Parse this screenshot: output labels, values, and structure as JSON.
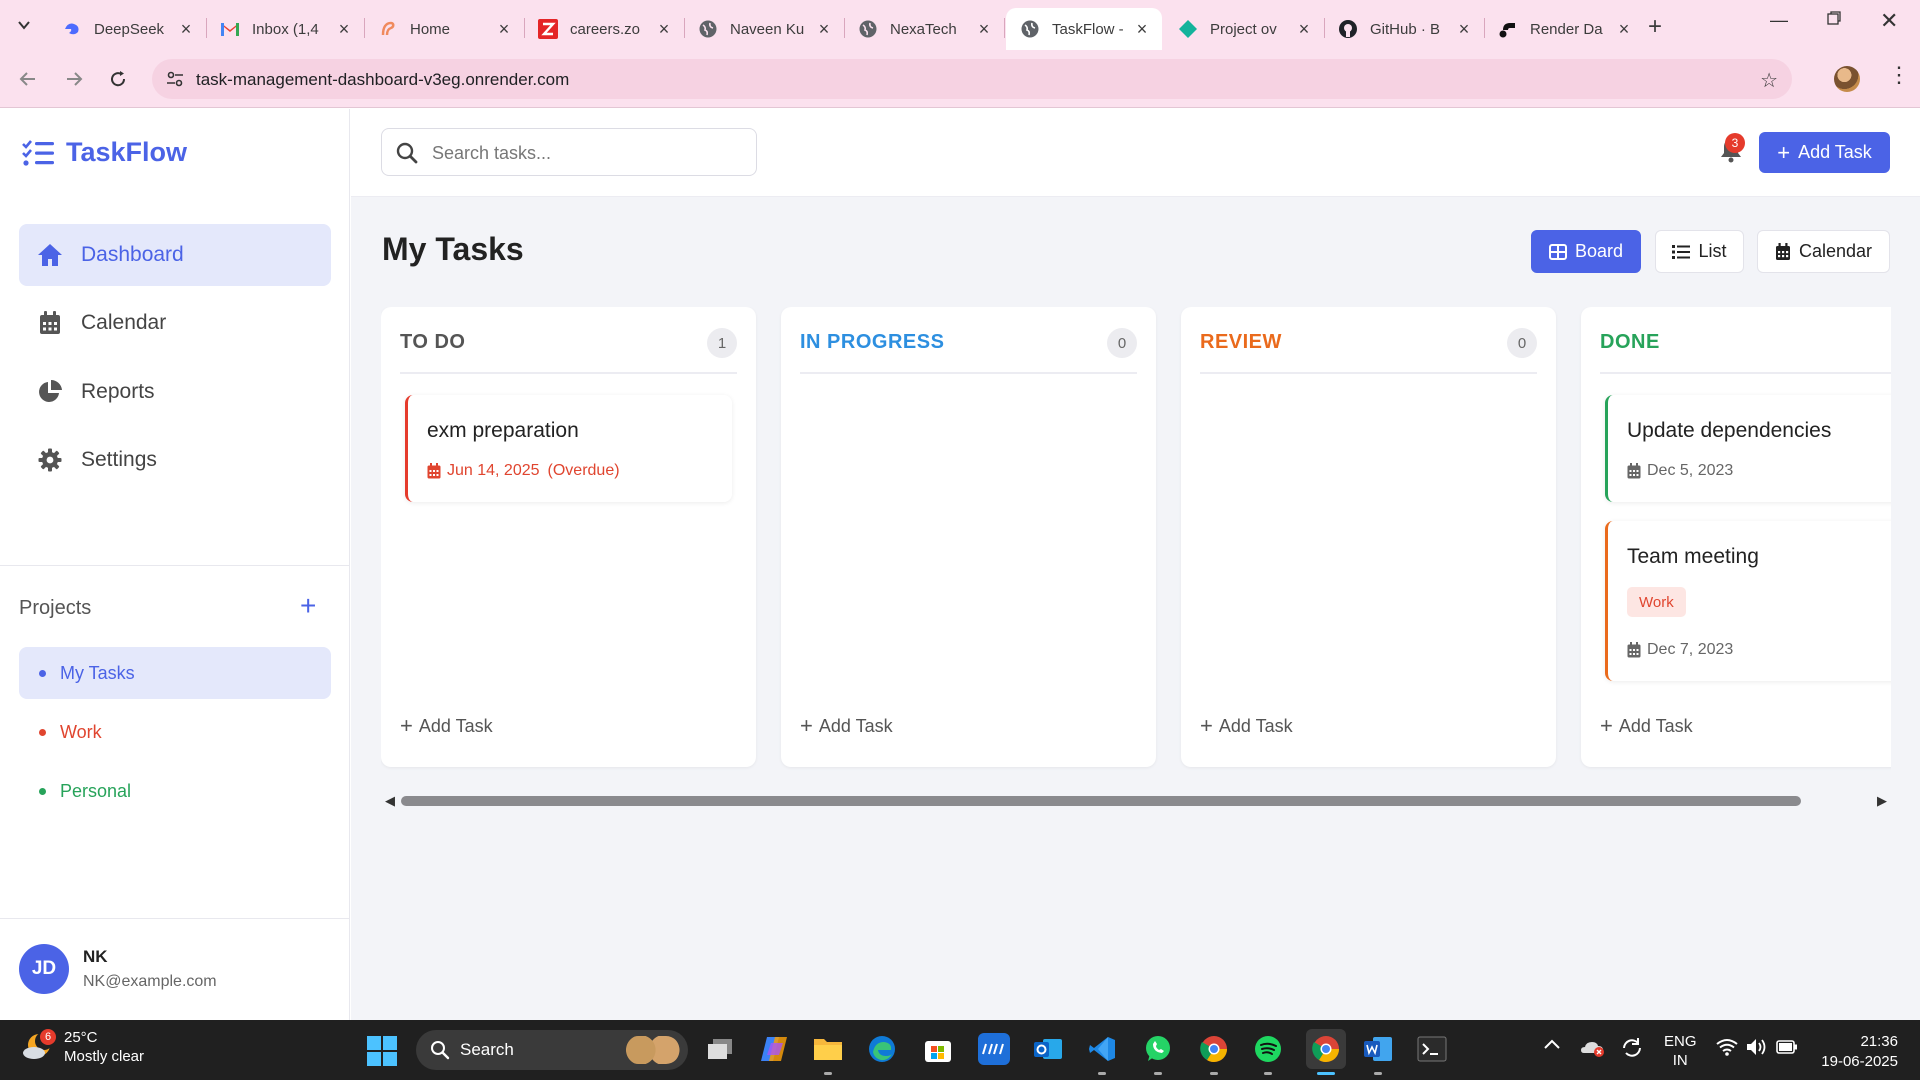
{
  "browser": {
    "tabs": [
      {
        "title": "DeepSeek",
        "icon": "deepseek-icon",
        "active": false
      },
      {
        "title": "Inbox (1,4",
        "icon": "gmail-icon",
        "active": false
      },
      {
        "title": "Home",
        "icon": "home-icon",
        "active": false
      },
      {
        "title": "careers.zo",
        "icon": "zoho-icon",
        "active": false
      },
      {
        "title": "Naveen Ku",
        "icon": "globe-icon",
        "active": false
      },
      {
        "title": "NexaTech",
        "icon": "globe-icon",
        "active": false
      },
      {
        "title": "TaskFlow -",
        "icon": "globe-icon",
        "active": true
      },
      {
        "title": "Project ov",
        "icon": "diamond-icon",
        "active": false
      },
      {
        "title": "GitHub · B",
        "icon": "github-icon",
        "active": false
      },
      {
        "title": "Render Da",
        "icon": "render-icon",
        "active": false
      }
    ],
    "url": "task-management-dashboard-v3eg.onrender.com"
  },
  "sidebar": {
    "logo": "TaskFlow",
    "nav": [
      {
        "label": "Dashboard",
        "icon": "home-icon",
        "active": true
      },
      {
        "label": "Calendar",
        "icon": "calendar-icon",
        "active": false
      },
      {
        "label": "Reports",
        "icon": "pie-chart-icon",
        "active": false
      },
      {
        "label": "Settings",
        "icon": "gear-icon",
        "active": false
      }
    ],
    "projects_title": "Projects",
    "projects": [
      {
        "label": "My Tasks",
        "color": "#4b63e6",
        "active": true
      },
      {
        "label": "Work",
        "color": "#e0452f",
        "active": false
      },
      {
        "label": "Personal",
        "color": "#27a35a",
        "active": false
      }
    ],
    "user": {
      "initials": "JD",
      "name": "NK",
      "email": "NK@example.com"
    }
  },
  "topbar": {
    "search_placeholder": "Search tasks...",
    "notification_count": "3",
    "add_task_label": "Add Task"
  },
  "main": {
    "title": "My Tasks",
    "views": [
      {
        "label": "Board",
        "icon": "grid-icon",
        "active": true
      },
      {
        "label": "List",
        "icon": "list-icon",
        "active": false
      },
      {
        "label": "Calendar",
        "icon": "calendar-icon",
        "active": false
      }
    ],
    "add_task_label": "Add Task",
    "columns": [
      {
        "title": "TO DO",
        "count": "1",
        "color": "#555555",
        "cards": [
          {
            "title": "exm preparation",
            "date": "Jun 14, 2025",
            "overdue": "(Overdue)",
            "border": "#e53b2c",
            "tag": ""
          }
        ]
      },
      {
        "title": "IN PROGRESS",
        "count": "0",
        "color": "#2d8fe0",
        "cards": []
      },
      {
        "title": "REVIEW",
        "count": "0",
        "color": "#ea6a1c",
        "cards": []
      },
      {
        "title": "DONE",
        "count": "",
        "color": "#27a35a",
        "cards": [
          {
            "title": "Update dependencies",
            "date": "Dec 5, 2023",
            "border": "#27a35a",
            "tag": ""
          },
          {
            "title": "Team meeting",
            "date": "Dec 7, 2023",
            "border": "#ea6a1c",
            "tag": "Work"
          }
        ]
      }
    ]
  },
  "taskbar": {
    "weather_badge": "6",
    "temperature": "25°C",
    "condition": "Mostly clear",
    "search_label": "Search",
    "lang_top": "ENG",
    "lang_bottom": "IN",
    "time": "21:36",
    "date": "19-06-2025"
  }
}
